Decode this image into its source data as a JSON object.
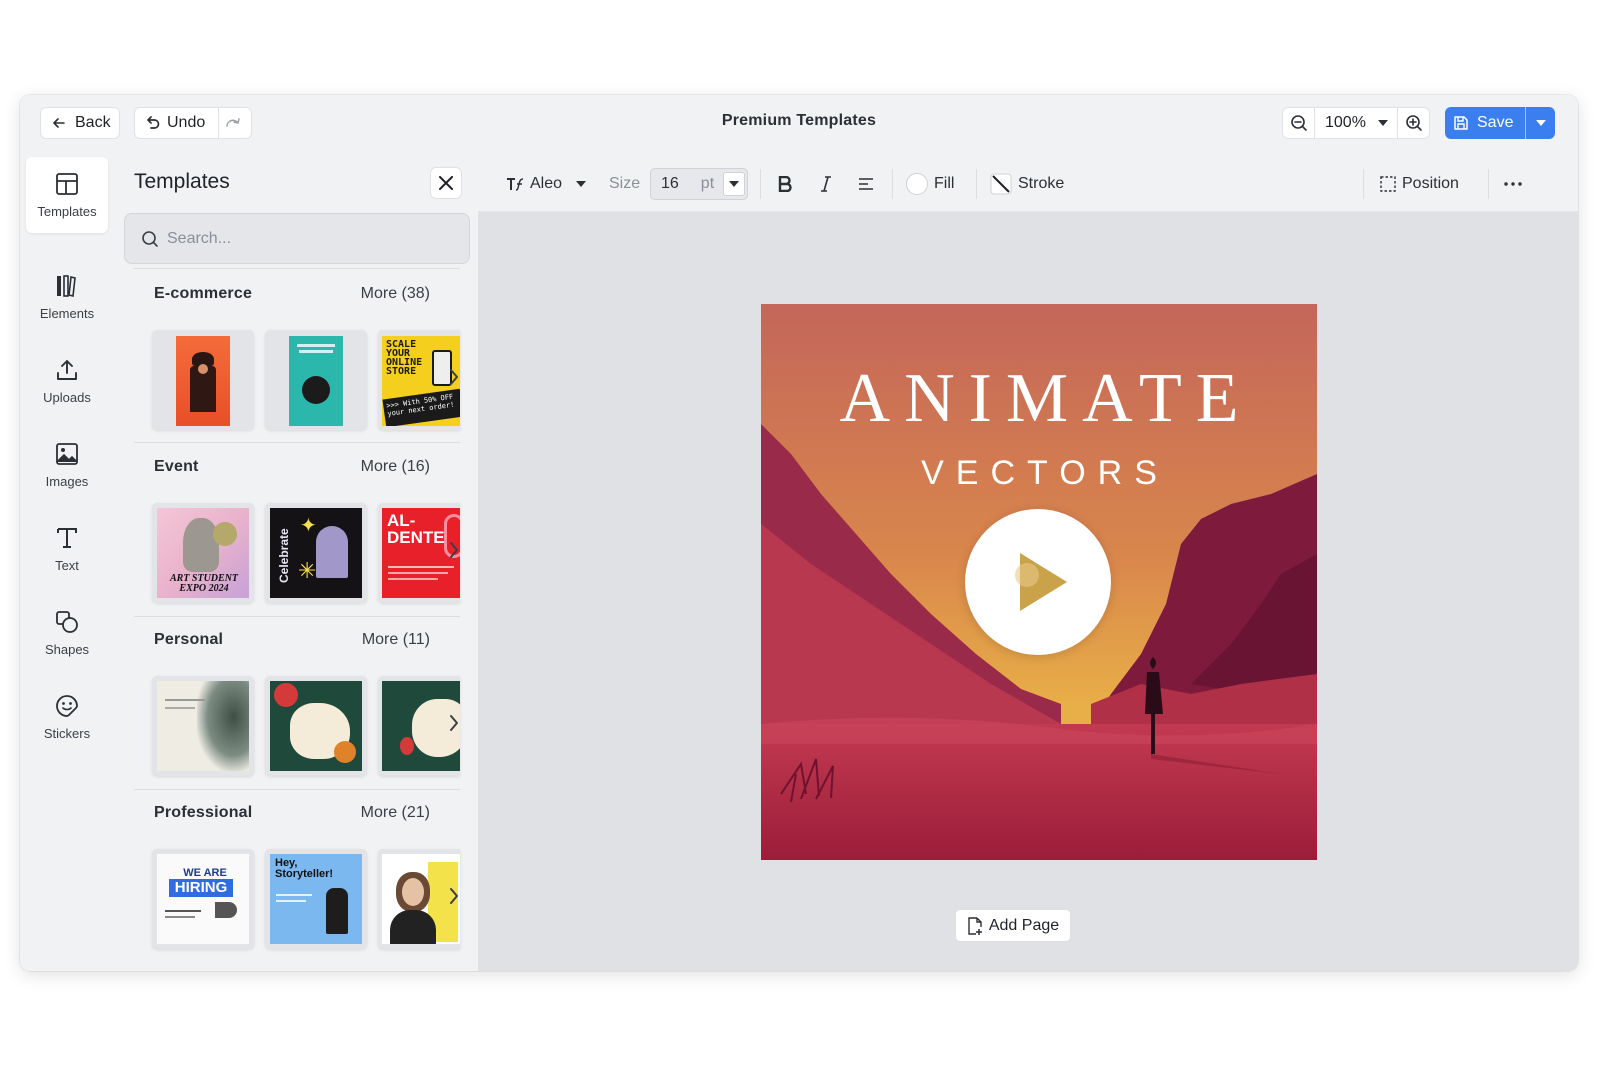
{
  "header": {
    "back_label": "Back",
    "undo_label": "Undo",
    "title": "Premium Templates",
    "zoom": "100%",
    "save_label": "Save"
  },
  "rail": {
    "items": [
      {
        "label": "Templates",
        "icon": "layout-icon"
      },
      {
        "label": "Elements",
        "icon": "elements-icon"
      },
      {
        "label": "Uploads",
        "icon": "upload-icon"
      },
      {
        "label": "Images",
        "icon": "image-icon"
      },
      {
        "label": "Text",
        "icon": "text-icon"
      },
      {
        "label": "Shapes",
        "icon": "shapes-icon"
      },
      {
        "label": "Stickers",
        "icon": "sticker-icon"
      }
    ]
  },
  "panel": {
    "title": "Templates",
    "search_placeholder": "Search...",
    "categories": [
      {
        "name": "E-commerce",
        "more": "More (38)"
      },
      {
        "name": "Event",
        "more": "More (16)"
      },
      {
        "name": "Personal",
        "more": "More (11)"
      },
      {
        "name": "Professional",
        "more": "More (21)"
      }
    ],
    "thumb_text": {
      "ecom3": "SCALE YOUR ONLINE STORE",
      "ecom3_small": ">>> With 50% OFF your next order!",
      "event1": "ART STUDENT EXPO 2024",
      "event2": "Celebrate",
      "event3": "AL- DENTE",
      "prof1_a": "WE ARE",
      "prof1_b": "HIRING",
      "prof2": "Hey, Storyteller!"
    }
  },
  "format": {
    "font": "Aleo",
    "size_label": "Size",
    "size_value": "16",
    "size_unit": "pt",
    "fill_label": "Fill",
    "stroke_label": "Stroke",
    "position_label": "Position"
  },
  "canvas": {
    "headline": "ANIMATE",
    "subline": "VECTORS",
    "add_page_label": "Add Page"
  },
  "colors": {
    "accent": "#3b7ef0",
    "sky_top": "#c4665a",
    "sky_mid": "#e2a04a",
    "ground": "#a81f3f"
  }
}
